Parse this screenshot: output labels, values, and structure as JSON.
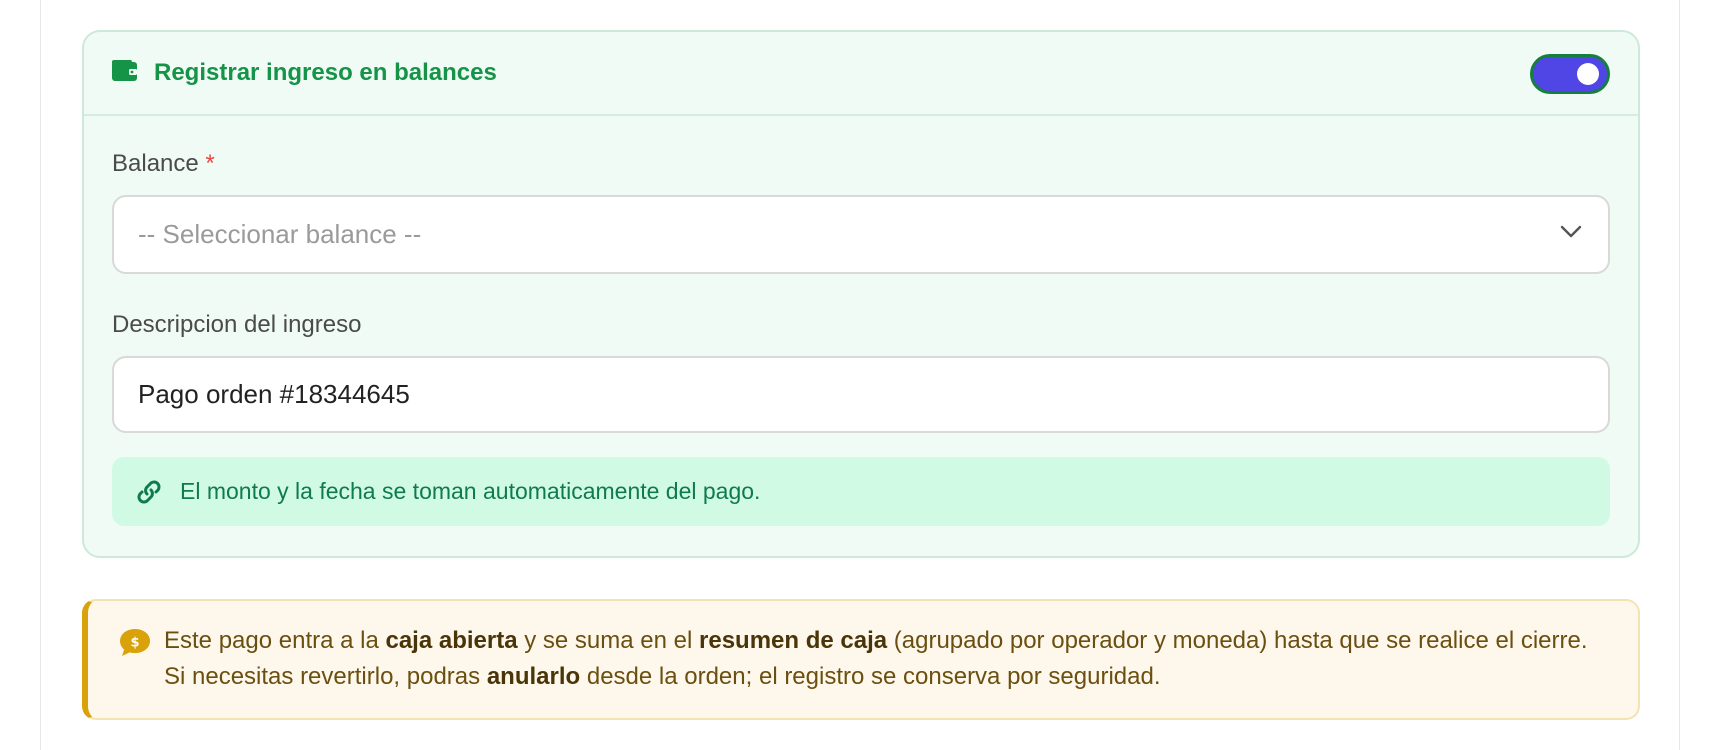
{
  "income_section": {
    "title": "Registrar ingreso en balances",
    "toggle_on": true,
    "balance_field": {
      "label": "Balance",
      "required_mark": "*",
      "placeholder": "-- Seleccionar balance --"
    },
    "description_field": {
      "label": "Descripcion del ingreso",
      "value": "Pago orden #18344645"
    },
    "info": "El monto y la fecha se toman automaticamente del pago."
  },
  "note": {
    "p1": "Este pago entra a la ",
    "b1": "caja abierta",
    "p2": " y se suma en el ",
    "b2": "resumen de caja",
    "p3": " (agrupado por operador y moneda) hasta que se realice el cierre. Si necesitas revertirlo, podras ",
    "b3": "anularlo",
    "p4": " desde la orden; el registro se conserva por seguridad."
  },
  "colors": {
    "accent_green": "#159447",
    "toggle_bg": "#4f46e5",
    "info_bg": "#d1fae5",
    "note_border": "#d9a10a"
  },
  "icons": {
    "header": "wallet-icon",
    "info": "link-icon",
    "note": "dollar-chat-icon",
    "select": "chevron-down-icon"
  }
}
